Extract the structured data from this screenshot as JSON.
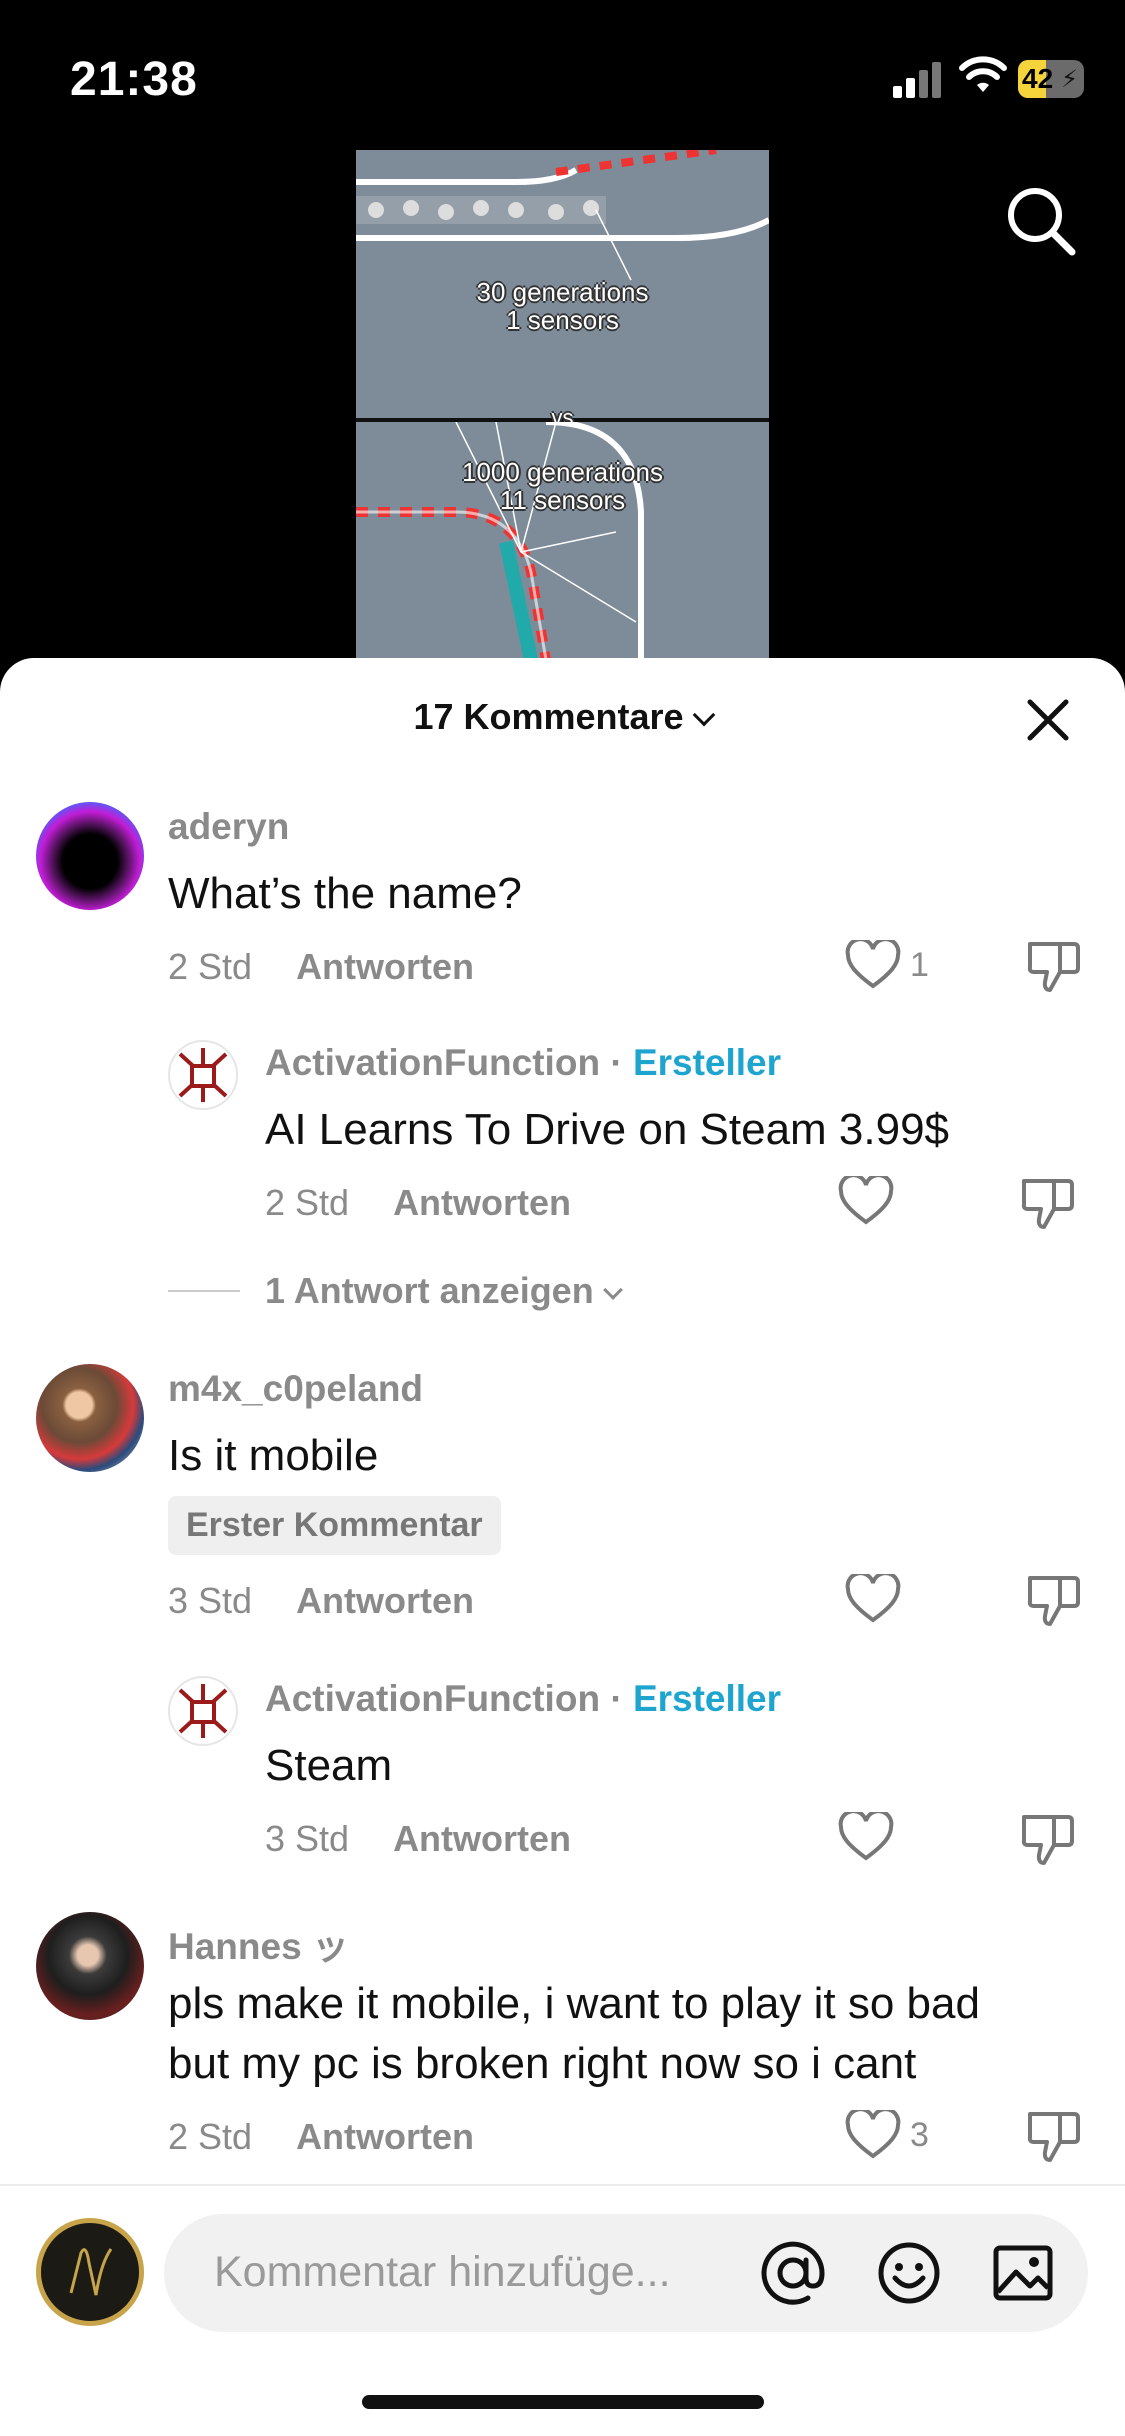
{
  "status_bar": {
    "time": "21:38",
    "battery": "42",
    "battery_level": 0.42
  },
  "video": {
    "top_label_line1": "30 generations",
    "top_label_line2": "1 sensors",
    "vs_label": "vs",
    "bottom_label_line1": "1000 generations",
    "bottom_label_line2": "11 sensors"
  },
  "sheet": {
    "title": "17 Kommentare"
  },
  "comments": [
    {
      "username": "aderyn",
      "text": "What’s the name?",
      "time": "2 Std",
      "reply_label": "Antworten",
      "likes": "1"
    },
    {
      "username": "ActivationFunction",
      "separator": "·",
      "creator_label": "Ersteller",
      "text": "AI Learns To Drive on Steam 3.99$",
      "time": "2 Std",
      "reply_label": "Antworten"
    },
    {
      "username": "m4x_c0peland",
      "text": "Is it mobile",
      "badge": "Erster Kommentar",
      "time": "3 Std",
      "reply_label": "Antworten"
    },
    {
      "username": "ActivationFunction",
      "separator": "·",
      "creator_label": "Ersteller",
      "text": "Steam",
      "time": "3 Std",
      "reply_label": "Antworten"
    },
    {
      "username": "Hannes ッ",
      "text_line1": "pls make it mobile, i want to play it so bad",
      "text_line2": "but my pc is broken right now so i cant",
      "time": "2 Std",
      "reply_label": "Antworten",
      "likes": "3"
    }
  ],
  "more_replies": "1 Antwort anzeigen",
  "composer": {
    "placeholder": "Kommentar hinzufüge..."
  },
  "colors": {
    "creator": "#1da4cf",
    "meta": "#8a8a8a",
    "battery": "#f5d33b"
  }
}
